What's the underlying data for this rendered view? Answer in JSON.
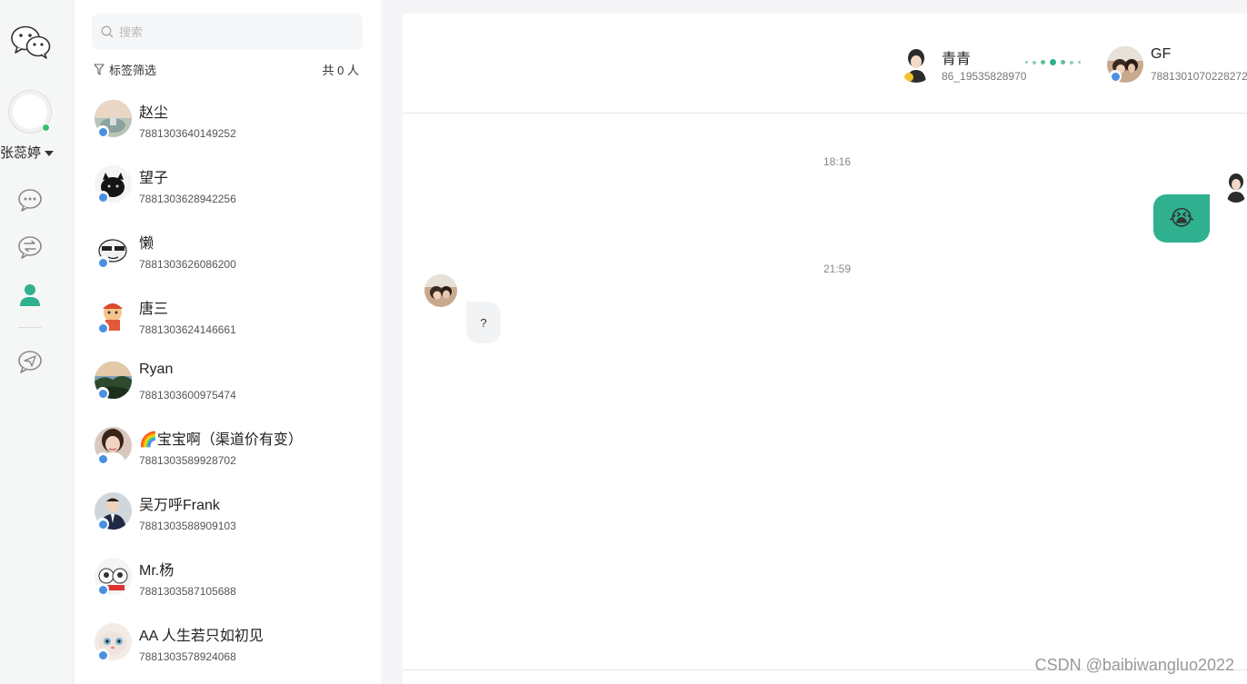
{
  "user": {
    "name": "张蕊婷"
  },
  "search": {
    "placeholder": "搜索"
  },
  "filter": {
    "label": "标签筛选",
    "count": "共 0 人"
  },
  "contacts": [
    {
      "name": "赵尘",
      "id": "7881303640149252"
    },
    {
      "name": "望子",
      "id": "7881303628942256"
    },
    {
      "name": "懒",
      "id": "7881303626086200"
    },
    {
      "name": "唐三",
      "id": "7881303624146661"
    },
    {
      "name": "Ryan",
      "id": "7881303600975474"
    },
    {
      "name": "🌈宝宝啊（渠道价有变）",
      "id": "7881303589928702"
    },
    {
      "name": "吴万呼Frank",
      "id": "7881303588909103"
    },
    {
      "name": "Mr.杨",
      "id": "7881303587105688"
    },
    {
      "name": "AA 人生若只如初见",
      "id": "7881303578924068"
    }
  ],
  "chat": {
    "left_party": {
      "name": "青青",
      "id": "86_19535828970"
    },
    "right_party": {
      "name": "GF",
      "id": "7881301070228272"
    },
    "messages": [
      {
        "time": "18:16",
        "direction": "out",
        "content": "😭"
      },
      {
        "time": "21:59",
        "direction": "in",
        "content": "?"
      }
    ]
  },
  "watermark": "CSDN @baibiwangluo2022",
  "colors": {
    "accent": "#2fb08f",
    "online": "#3bbd6d",
    "badge": "#4a90e2"
  }
}
